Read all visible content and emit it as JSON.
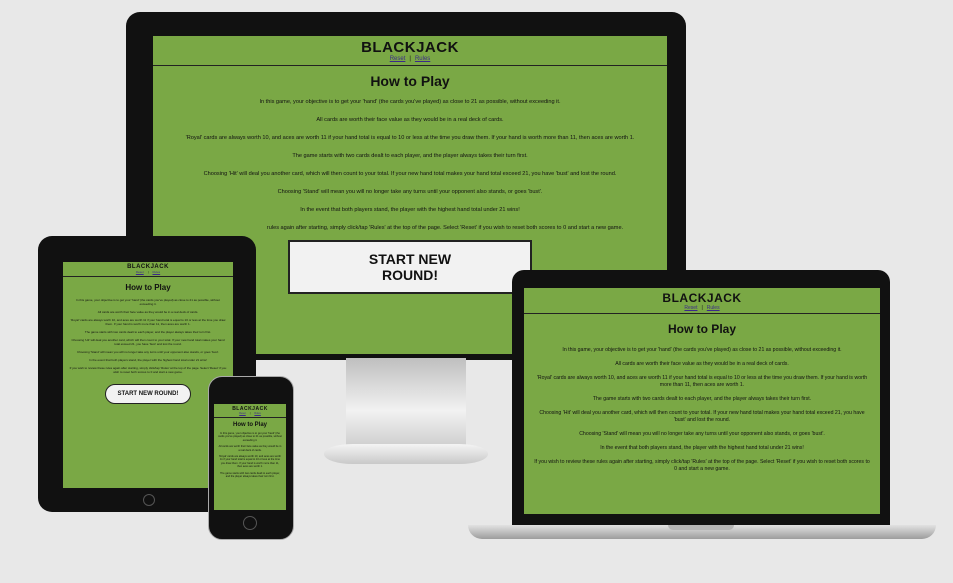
{
  "app": {
    "title": "BLACKJACK",
    "nav": {
      "reset": "Reset",
      "separator": "|",
      "rules": "Rules"
    }
  },
  "rules": {
    "heading": "How to Play",
    "paragraphs": [
      "In this game, your objective is to get your 'hand' (the cards you've played) as close to 21 as possible, without exceeding it.",
      "All cards are worth their face value as they would be in a real deck of cards.",
      "'Royal' cards are always worth 10, and aces are worth 11 if your hand total is equal to 10 or less at the time you draw them. If your hand is worth more than 11, then aces are worth 1.",
      "The game starts with two cards dealt to each player, and the player always takes their turn first.",
      "Choosing 'Hit' will deal you another card, which will then count to your total. If your new hand total makes your hand total exceed 21, you have 'bust' and lost the round.",
      "Choosing 'Stand' will mean you will no longer take any turns until your opponent also stands, or goes 'bust'.",
      "In the event that both players stand, the player with the highest hand total under 21 wins!",
      "If you wish to review these rules again after starting, simply click/tap 'Rules' at the top of the page. Select 'Reset' if you wish to reset both scores to 0 and start a new game."
    ],
    "monitor_last_paragraph": "rules again after starting, simply click/tap 'Rules' at the top of the page. Select 'Reset' if you wish to reset both scores to 0 and start a new game."
  },
  "start_button": "START NEW ROUND!",
  "colors": {
    "page_bg": "#7aa845",
    "nav_link": "#3c2a8a"
  }
}
